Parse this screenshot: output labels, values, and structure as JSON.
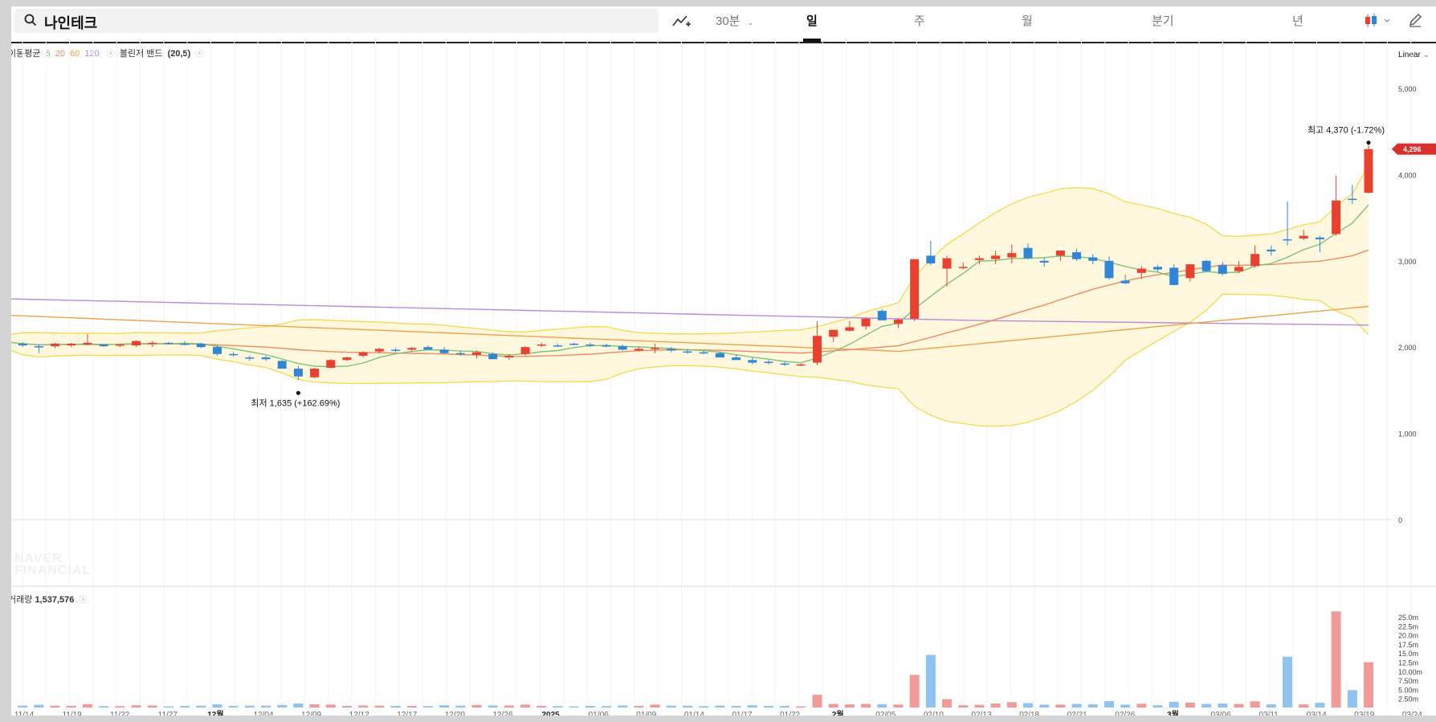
{
  "search": {
    "query": "나인테크"
  },
  "toolbar": {
    "interval": "30분",
    "tabs": [
      "일",
      "주",
      "월",
      "분기",
      "년"
    ],
    "active_tab": "일"
  },
  "indicators": {
    "ma_label": "이동평균",
    "ma_periods": [
      "5",
      "20",
      "60",
      "120"
    ],
    "bb_label": "볼린저 밴드",
    "bb_params": "(20,5)"
  },
  "scale": "Linear",
  "volume": {
    "label": "거래량",
    "value": "1,537,576"
  },
  "watermark": [
    "NAVER",
    "FINANCIAL"
  ],
  "colors": {
    "up": "#e8412f",
    "down": "#2f86d6",
    "ma5": "#7cc576",
    "ma20": "#f08a5d",
    "ma60": "#f0a24a",
    "ma120": "#b98ad9",
    "band": "#f6d94d",
    "bandfill": "#fff8df"
  },
  "chart_data": {
    "type": "candlestick",
    "x_tick_labels": [
      "11/14",
      "11/19",
      "11/22",
      "11/27",
      "12월",
      "12/04",
      "12/09",
      "12/12",
      "12/17",
      "12/20",
      "12/26",
      "2025",
      "01/06",
      "01/09",
      "01/14",
      "01/17",
      "01/22",
      "2월",
      "02/05",
      "02/10",
      "02/13",
      "02/18",
      "02/21",
      "02/26",
      "3월",
      "03/06",
      "03/11",
      "03/14",
      "03/19",
      "03/24"
    ],
    "y_ticks": [
      "0",
      "1,000",
      "2,000",
      "3,000",
      "4,000",
      "5,000"
    ],
    "ylim": [
      0,
      5200
    ],
    "vol_ticks": [
      "2.50m",
      "5.00m",
      "7.50m",
      "10.00m",
      "12.5m",
      "15.0m",
      "17.5m",
      "20.0m",
      "22.5m",
      "25.0m"
    ],
    "vol_ylim": [
      0,
      26000000
    ],
    "ohlc": [
      [
        2090,
        2120,
        2040,
        2060
      ],
      [
        2040,
        2060,
        2000,
        2020
      ],
      [
        2010,
        2030,
        1930,
        2000
      ],
      [
        2010,
        2050,
        1990,
        2040
      ],
      [
        2020,
        2050,
        2000,
        2040
      ],
      [
        2030,
        2150,
        2020,
        2050
      ],
      [
        2030,
        2040,
        2000,
        2010
      ],
      [
        2020,
        2040,
        2000,
        2030
      ],
      [
        2020,
        2080,
        2000,
        2070
      ],
      [
        2040,
        2070,
        2000,
        2050
      ],
      [
        2050,
        2060,
        2030,
        2040
      ],
      [
        2040,
        2070,
        2020,
        2030
      ],
      [
        2040,
        2050,
        1990,
        2000
      ],
      [
        2000,
        2020,
        1900,
        1920
      ],
      [
        1920,
        1940,
        1890,
        1910
      ],
      [
        1880,
        1900,
        1840,
        1870
      ],
      [
        1880,
        1900,
        1840,
        1860
      ],
      [
        1840,
        1850,
        1760,
        1750
      ],
      [
        1750,
        1780,
        1620,
        1660
      ],
      [
        1650,
        1760,
        1640,
        1750
      ],
      [
        1760,
        1860,
        1750,
        1850
      ],
      [
        1850,
        1890,
        1840,
        1880
      ],
      [
        1900,
        1950,
        1880,
        1940
      ],
      [
        1950,
        1990,
        1930,
        1980
      ],
      [
        1970,
        1990,
        1940,
        1960
      ],
      [
        1970,
        2000,
        1950,
        1990
      ],
      [
        2000,
        2020,
        1980,
        1970
      ],
      [
        1970,
        2000,
        1920,
        1930
      ],
      [
        1930,
        1960,
        1900,
        1920
      ],
      [
        1910,
        1960,
        1870,
        1940
      ],
      [
        1920,
        1940,
        1870,
        1860
      ],
      [
        1880,
        1920,
        1850,
        1900
      ],
      [
        1920,
        2010,
        1900,
        2000
      ],
      [
        2020,
        2050,
        2000,
        2030
      ],
      [
        2020,
        2040,
        2000,
        2010
      ],
      [
        2040,
        2050,
        2020,
        2030
      ],
      [
        2030,
        2050,
        2000,
        2020
      ],
      [
        2020,
        2040,
        2000,
        2010
      ],
      [
        2010,
        2030,
        1960,
        1970
      ],
      [
        1960,
        2000,
        1950,
        1980
      ],
      [
        1990,
        2040,
        1930,
        1990
      ],
      [
        1980,
        2000,
        1940,
        1960
      ],
      [
        1950,
        1980,
        1920,
        1940
      ],
      [
        1940,
        1960,
        1920,
        1930
      ],
      [
        1930,
        1950,
        1890,
        1880
      ],
      [
        1880,
        1910,
        1860,
        1850
      ],
      [
        1850,
        1880,
        1800,
        1820
      ],
      [
        1830,
        1850,
        1800,
        1820
      ],
      [
        1810,
        1830,
        1780,
        1800
      ],
      [
        1790,
        1810,
        1780,
        1800
      ],
      [
        1820,
        2300,
        1790,
        2130
      ],
      [
        2120,
        2200,
        2060,
        2200
      ],
      [
        2190,
        2300,
        2180,
        2230
      ],
      [
        2240,
        2340,
        2200,
        2330
      ],
      [
        2420,
        2440,
        2310,
        2310
      ],
      [
        2270,
        2330,
        2220,
        2320
      ],
      [
        2330,
        3020,
        2300,
        3020
      ],
      [
        3060,
        3230,
        2950,
        2970
      ],
      [
        2910,
        3060,
        2700,
        3030
      ],
      [
        2920,
        2980,
        2900,
        2930
      ],
      [
        3010,
        3060,
        2960,
        3030
      ],
      [
        3020,
        3120,
        2960,
        3060
      ],
      [
        3040,
        3190,
        2970,
        3090
      ],
      [
        3150,
        3200,
        3020,
        3030
      ],
      [
        3000,
        3040,
        2930,
        2980
      ],
      [
        3060,
        3110,
        3000,
        3120
      ],
      [
        3100,
        3140,
        3000,
        3020
      ],
      [
        3040,
        3080,
        2960,
        3000
      ],
      [
        3000,
        3050,
        2780,
        2800
      ],
      [
        2770,
        2840,
        2730,
        2740
      ],
      [
        2860,
        2940,
        2790,
        2910
      ],
      [
        2930,
        2950,
        2870,
        2900
      ],
      [
        2920,
        2960,
        2720,
        2720
      ],
      [
        2800,
        2960,
        2760,
        2960
      ],
      [
        3000,
        3010,
        2870,
        2880
      ],
      [
        2950,
        2990,
        2830,
        2850
      ],
      [
        2880,
        3000,
        2860,
        2930
      ],
      [
        2940,
        3180,
        2920,
        3080
      ],
      [
        3130,
        3180,
        3060,
        3110
      ],
      [
        3250,
        3690,
        3180,
        3240
      ],
      [
        3260,
        3360,
        3240,
        3290
      ],
      [
        3270,
        3290,
        3100,
        3250
      ],
      [
        3310,
        3990,
        3290,
        3700
      ],
      [
        3720,
        3880,
        3660,
        3710
      ],
      [
        3790,
        4370,
        3780,
        4296
      ]
    ],
    "high": {
      "label": "최고",
      "value": "4,370",
      "pct": "(-1.72%)"
    },
    "low": {
      "label": "최저",
      "value": "1,635",
      "pct": "(+162.69%)"
    },
    "last_price": "4,296"
  }
}
